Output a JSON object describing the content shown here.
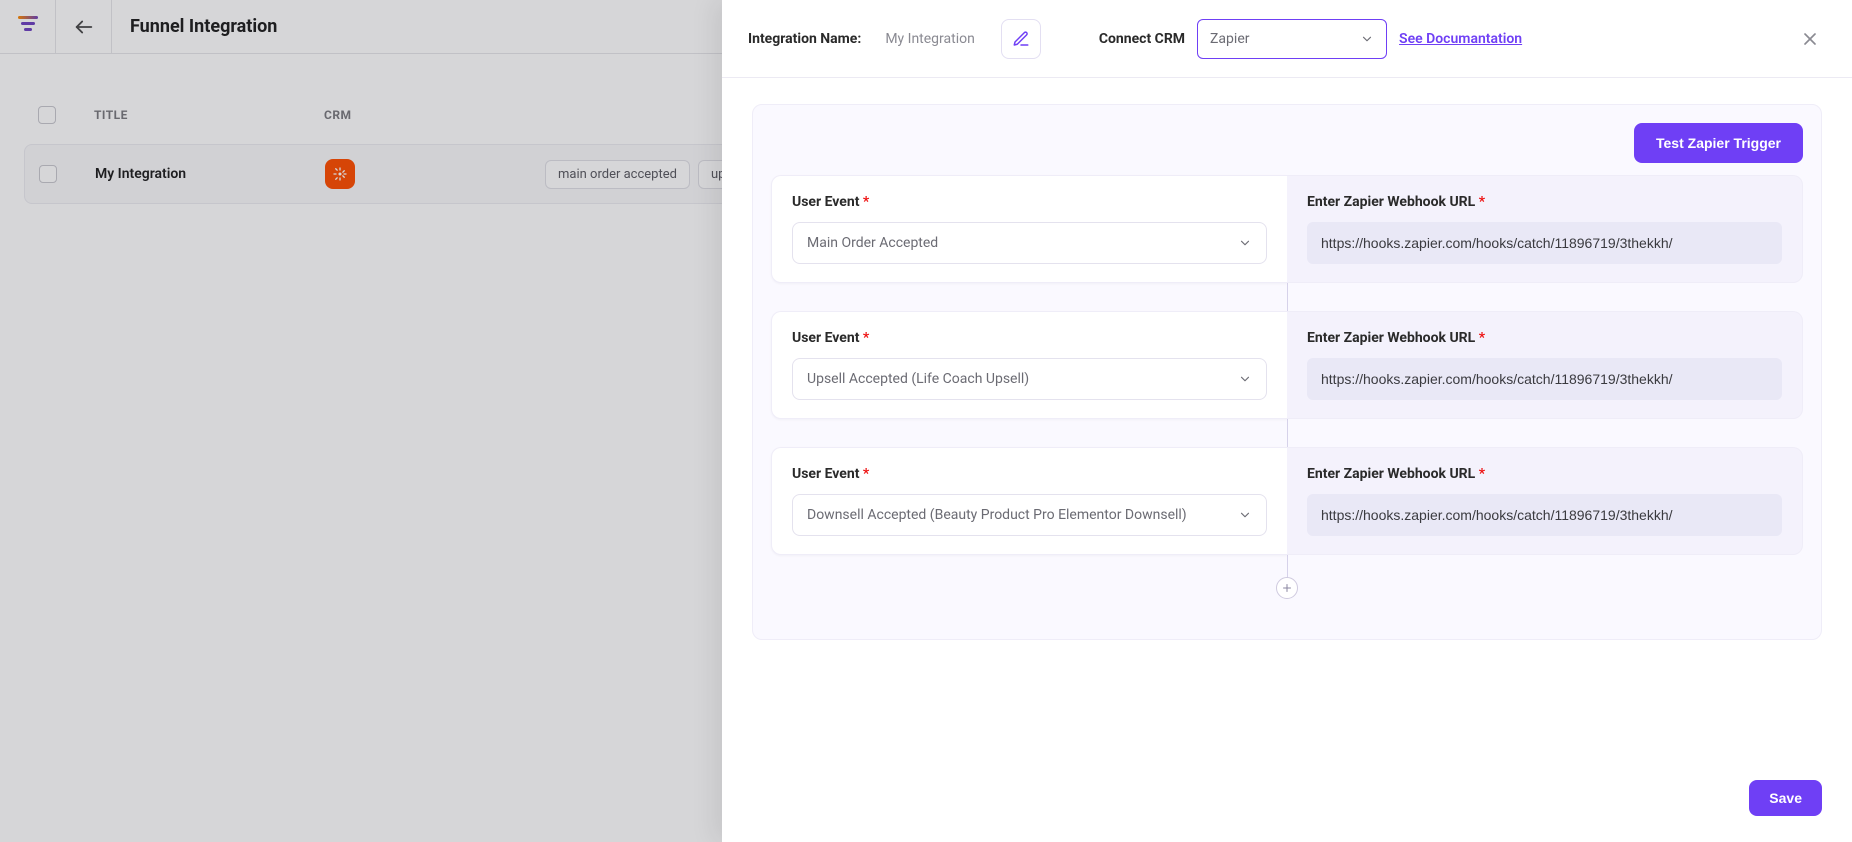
{
  "bg": {
    "page_title": "Funnel Integration",
    "columns": {
      "title": "TITLE",
      "crm": "CRM"
    },
    "row": {
      "title": "My Integration",
      "tags": [
        "main order accepted",
        "ups"
      ]
    }
  },
  "panel": {
    "name_label": "Integration Name:",
    "name_value": "My Integration",
    "connect_crm_label": "Connect CRM",
    "crm_selected": "Zapier",
    "doc_link": "See Documantation",
    "test_button": "Test Zapier Trigger",
    "user_event_label": "User Event",
    "webhook_label": "Enter Zapier Webhook URL",
    "events": [
      {
        "event": "Main Order Accepted",
        "url": "https://hooks.zapier.com/hooks/catch/11896719/3thekkh/"
      },
      {
        "event": "Upsell Accepted (Life Coach Upsell)",
        "url": "https://hooks.zapier.com/hooks/catch/11896719/3thekkh/"
      },
      {
        "event": "Downsell Accepted (Beauty Product Pro Elementor Downsell)",
        "url": "https://hooks.zapier.com/hooks/catch/11896719/3thekkh/"
      }
    ],
    "save_label": "Save"
  }
}
